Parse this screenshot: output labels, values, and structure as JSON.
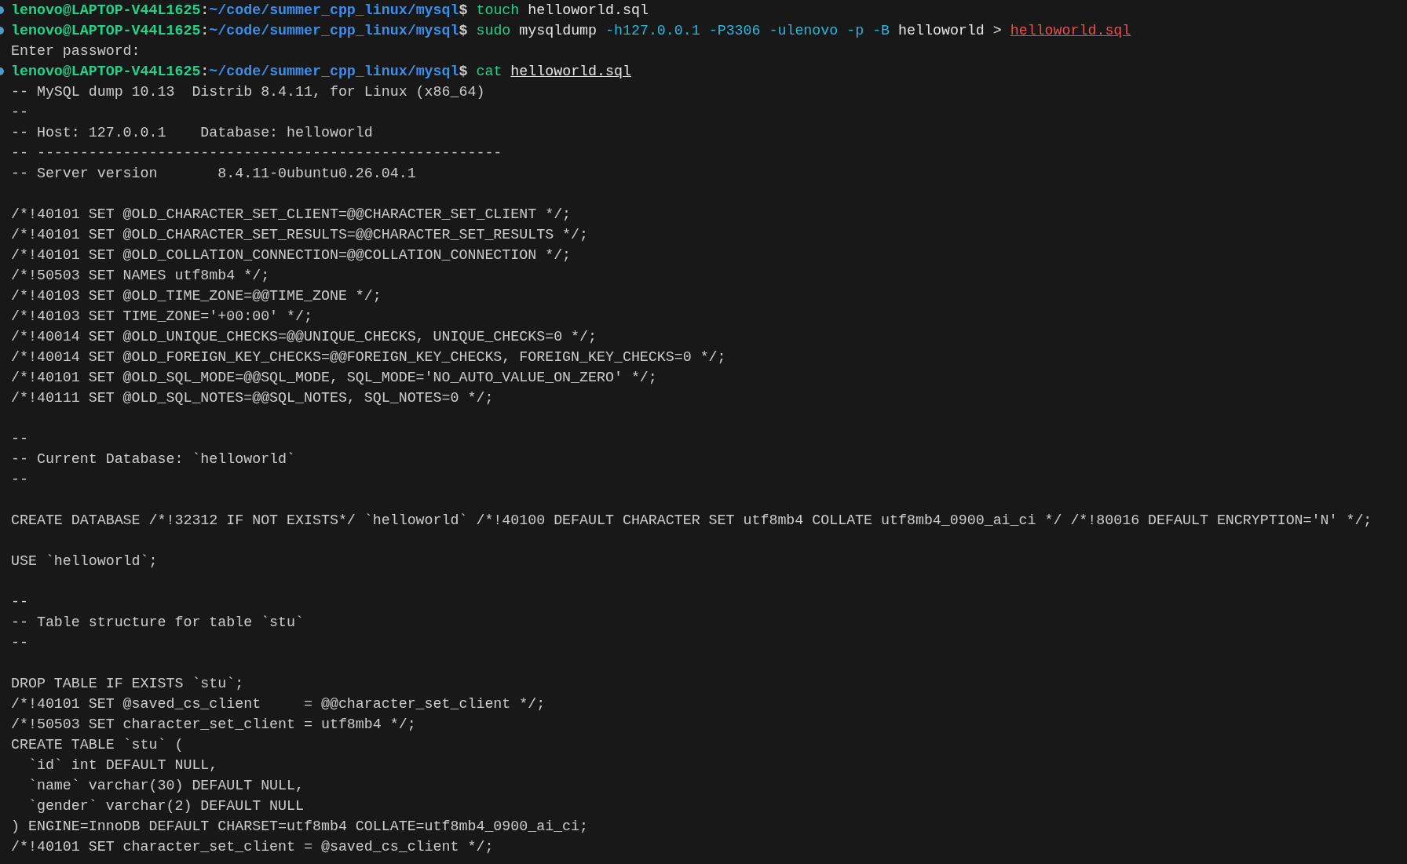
{
  "terminal": {
    "lines": [
      {
        "kind": "prompt",
        "user": "lenovo@LAPTOP-V44L1625",
        "sep": ":",
        "path": "~/code/summer_cpp_linux/mysql",
        "sigil": "$",
        "segments": [
          {
            "text": "touch",
            "kind": "command"
          },
          {
            "text": "helloworld.sql",
            "kind": "arg"
          }
        ]
      },
      {
        "kind": "prompt",
        "user": "lenovo@LAPTOP-V44L1625",
        "sep": ":",
        "path": "~/code/summer_cpp_linux/mysql",
        "sigil": "$",
        "segments": [
          {
            "text": "sudo",
            "kind": "command"
          },
          {
            "text": "mysqldump",
            "kind": "arg"
          },
          {
            "text": "-h127.0.0.1",
            "kind": "flag"
          },
          {
            "text": "-P3306",
            "kind": "flag"
          },
          {
            "text": "-ulenovo",
            "kind": "flag"
          },
          {
            "text": "-p",
            "kind": "flag"
          },
          {
            "text": "-B",
            "kind": "flag"
          },
          {
            "text": "helloworld",
            "kind": "arg"
          },
          {
            "text": ">",
            "kind": "arg"
          },
          {
            "text": "helloworld.sql",
            "kind": "error-link"
          }
        ]
      },
      {
        "kind": "output",
        "text": "Enter password:"
      },
      {
        "kind": "prompt",
        "user": "lenovo@LAPTOP-V44L1625",
        "sep": ":",
        "path": "~/code/summer_cpp_linux/mysql",
        "sigil": "$",
        "segments": [
          {
            "text": "cat",
            "kind": "command"
          },
          {
            "text": "helloworld.sql",
            "kind": "link"
          }
        ]
      },
      {
        "kind": "output",
        "text": "-- MySQL dump 10.13  Distrib 8.4.11, for Linux (x86_64)"
      },
      {
        "kind": "output",
        "text": "--"
      },
      {
        "kind": "output",
        "text": "-- Host: 127.0.0.1    Database: helloworld"
      },
      {
        "kind": "output",
        "text": "-- ------------------------------------------------------"
      },
      {
        "kind": "output",
        "text": "-- Server version       8.4.11-0ubuntu0.26.04.1"
      },
      {
        "kind": "blank"
      },
      {
        "kind": "output",
        "text": "/*!40101 SET @OLD_CHARACTER_SET_CLIENT=@@CHARACTER_SET_CLIENT */;"
      },
      {
        "kind": "output",
        "text": "/*!40101 SET @OLD_CHARACTER_SET_RESULTS=@@CHARACTER_SET_RESULTS */;"
      },
      {
        "kind": "output",
        "text": "/*!40101 SET @OLD_COLLATION_CONNECTION=@@COLLATION_CONNECTION */;"
      },
      {
        "kind": "output",
        "text": "/*!50503 SET NAMES utf8mb4 */;"
      },
      {
        "kind": "output",
        "text": "/*!40103 SET @OLD_TIME_ZONE=@@TIME_ZONE */;"
      },
      {
        "kind": "output",
        "text": "/*!40103 SET TIME_ZONE='+00:00' */;"
      },
      {
        "kind": "output",
        "text": "/*!40014 SET @OLD_UNIQUE_CHECKS=@@UNIQUE_CHECKS, UNIQUE_CHECKS=0 */;"
      },
      {
        "kind": "output",
        "text": "/*!40014 SET @OLD_FOREIGN_KEY_CHECKS=@@FOREIGN_KEY_CHECKS, FOREIGN_KEY_CHECKS=0 */;"
      },
      {
        "kind": "output",
        "text": "/*!40101 SET @OLD_SQL_MODE=@@SQL_MODE, SQL_MODE='NO_AUTO_VALUE_ON_ZERO' */;"
      },
      {
        "kind": "output",
        "text": "/*!40111 SET @OLD_SQL_NOTES=@@SQL_NOTES, SQL_NOTES=0 */;"
      },
      {
        "kind": "blank"
      },
      {
        "kind": "output",
        "text": "--"
      },
      {
        "kind": "output",
        "text": "-- Current Database: `helloworld`"
      },
      {
        "kind": "output",
        "text": "--"
      },
      {
        "kind": "blank"
      },
      {
        "kind": "output",
        "text": "CREATE DATABASE /*!32312 IF NOT EXISTS*/ `helloworld` /*!40100 DEFAULT CHARACTER SET utf8mb4 COLLATE utf8mb4_0900_ai_ci */ /*!80016 DEFAULT ENCRYPTION='N' */;"
      },
      {
        "kind": "blank"
      },
      {
        "kind": "output",
        "text": "USE `helloworld`;"
      },
      {
        "kind": "blank"
      },
      {
        "kind": "output",
        "text": "--"
      },
      {
        "kind": "output",
        "text": "-- Table structure for table `stu`"
      },
      {
        "kind": "output",
        "text": "--"
      },
      {
        "kind": "blank"
      },
      {
        "kind": "output",
        "text": "DROP TABLE IF EXISTS `stu`;"
      },
      {
        "kind": "output",
        "text": "/*!40101 SET @saved_cs_client     = @@character_set_client */;"
      },
      {
        "kind": "output",
        "text": "/*!50503 SET character_set_client = utf8mb4 */;"
      },
      {
        "kind": "output",
        "text": "CREATE TABLE `stu` ("
      },
      {
        "kind": "output",
        "text": "  `id` int DEFAULT NULL,"
      },
      {
        "kind": "output",
        "text": "  `name` varchar(30) DEFAULT NULL,"
      },
      {
        "kind": "output",
        "text": "  `gender` varchar(2) DEFAULT NULL"
      },
      {
        "kind": "output",
        "text": ") ENGINE=InnoDB DEFAULT CHARSET=utf8mb4 COLLATE=utf8mb4_0900_ai_ci;"
      },
      {
        "kind": "output",
        "text": "/*!40101 SET character_set_client = @saved_cs_client */;"
      }
    ]
  }
}
